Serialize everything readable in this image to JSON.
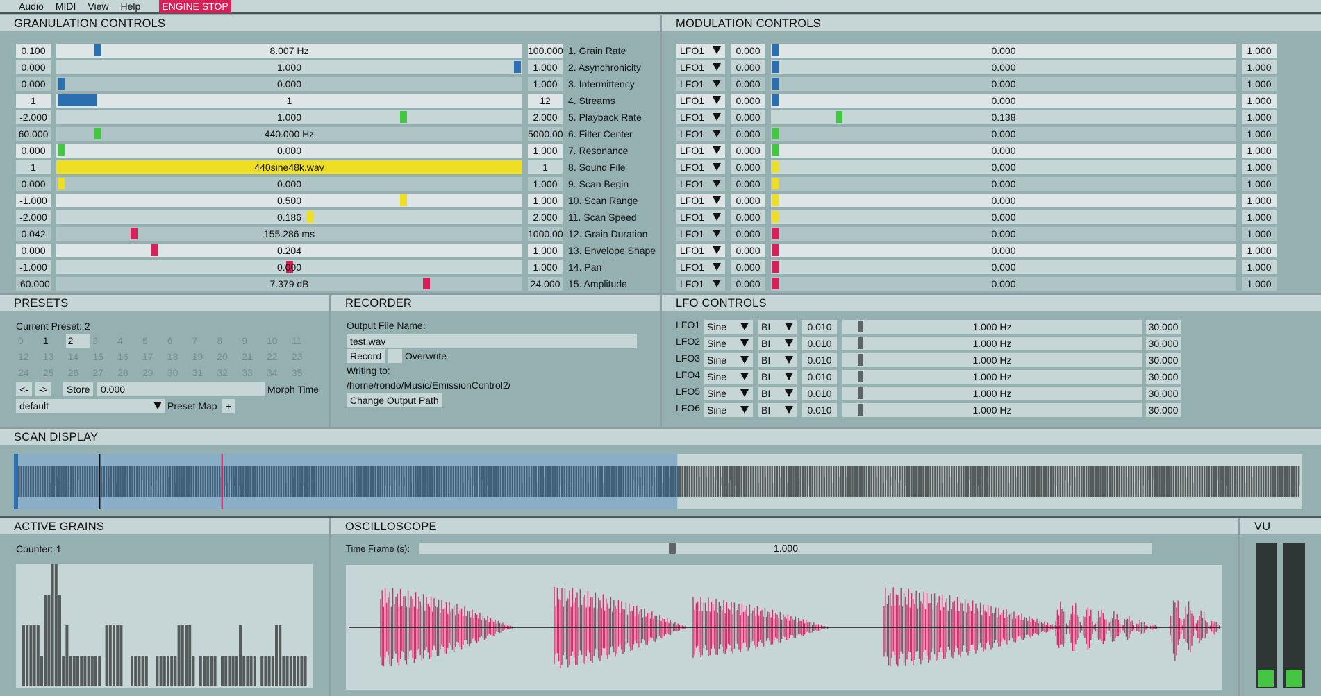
{
  "menu": {
    "items": [
      "Audio",
      "MIDI",
      "View",
      "Help"
    ],
    "engine_button": "ENGINE STOP"
  },
  "colors": {
    "accent_red": "#d52157",
    "blue": "#2c6fb0",
    "green": "#45c642",
    "yellow": "#efdf24",
    "panel": "#94b0b1",
    "header": "#c6d5d5"
  },
  "granulation": {
    "title": "GRANULATION CONTROLS",
    "rows": [
      {
        "min": "0.100",
        "value": "8.007 Hz",
        "max": "100.000",
        "label": "1. Grain Rate",
        "color": "blue",
        "pos": 0.08
      },
      {
        "min": "0.000",
        "value": "1.000",
        "max": "1.000",
        "label": "2. Asynchronicity",
        "color": "blue",
        "pos": 1.0
      },
      {
        "min": "0.000",
        "value": "0.000",
        "max": "1.000",
        "label": "3. Intermittency",
        "color": "blue",
        "pos": 0.0
      },
      {
        "min": "1",
        "value": "1",
        "max": "12",
        "label": "4. Streams",
        "color": "blue",
        "pos": 0.0,
        "fill": true
      },
      {
        "min": "-2.000",
        "value": "1.000",
        "max": "2.000",
        "label": "5. Playback Rate",
        "color": "green",
        "pos": 0.75
      },
      {
        "min": "60.000",
        "value": "440.000 Hz",
        "max": "5000.00",
        "label": "6. Filter Center",
        "color": "green",
        "pos": 0.08
      },
      {
        "min": "0.000",
        "value": "0.000",
        "max": "1.000",
        "label": "7. Resonance",
        "color": "green",
        "pos": 0.0
      },
      {
        "min": "1",
        "value": "440sine48k.wav",
        "max": "1",
        "label": "8. Sound File",
        "color": "yellow",
        "pos": 1.0,
        "full": true
      },
      {
        "min": "0.000",
        "value": "0.000",
        "max": "1.000",
        "label": "9. Scan Begin",
        "color": "yellow",
        "pos": 0.0
      },
      {
        "min": "-1.000",
        "value": "0.500",
        "max": "1.000",
        "label": "10. Scan Range",
        "color": "yellow",
        "pos": 0.75
      },
      {
        "min": "-2.000",
        "value": "0.186",
        "max": "2.000",
        "label": "11. Scan Speed",
        "color": "yellow",
        "pos": 0.546
      },
      {
        "min": "0.042",
        "value": "155.286 ms",
        "max": "1000.00",
        "label": "12. Grain Duration",
        "color": "red",
        "pos": 0.16
      },
      {
        "min": "0.000",
        "value": "0.204",
        "max": "1.000",
        "label": "13. Envelope Shape",
        "color": "red",
        "pos": 0.204
      },
      {
        "min": "-1.000",
        "value": "0.000",
        "max": "1.000",
        "label": "14. Pan",
        "color": "red",
        "pos": 0.5
      },
      {
        "min": "-60.000",
        "value": "7.379 dB",
        "max": "24.000",
        "label": "15. Amplitude",
        "color": "red",
        "pos": 0.8
      }
    ]
  },
  "modulation": {
    "title": "MODULATION CONTROLS",
    "rows": [
      {
        "source": "LFO1",
        "depth_min": "0.000",
        "value": "0.000",
        "max": "1.000",
        "color": "blue",
        "pos": 0.0
      },
      {
        "source": "LFO1",
        "depth_min": "0.000",
        "value": "0.000",
        "max": "1.000",
        "color": "blue",
        "pos": 0.0
      },
      {
        "source": "LFO1",
        "depth_min": "0.000",
        "value": "0.000",
        "max": "1.000",
        "color": "blue",
        "pos": 0.0
      },
      {
        "source": "LFO1",
        "depth_min": "0.000",
        "value": "0.000",
        "max": "1.000",
        "color": "blue",
        "pos": 0.0
      },
      {
        "source": "LFO1",
        "depth_min": "0.000",
        "value": "0.138",
        "max": "1.000",
        "color": "green",
        "pos": 0.138
      },
      {
        "source": "LFO1",
        "depth_min": "0.000",
        "value": "0.000",
        "max": "1.000",
        "color": "green",
        "pos": 0.0
      },
      {
        "source": "LFO1",
        "depth_min": "0.000",
        "value": "0.000",
        "max": "1.000",
        "color": "green",
        "pos": 0.0
      },
      {
        "source": "LFO1",
        "depth_min": "0.000",
        "value": "0.000",
        "max": "1.000",
        "color": "yellow",
        "pos": 0.0
      },
      {
        "source": "LFO1",
        "depth_min": "0.000",
        "value": "0.000",
        "max": "1.000",
        "color": "yellow",
        "pos": 0.0
      },
      {
        "source": "LFO1",
        "depth_min": "0.000",
        "value": "0.000",
        "max": "1.000",
        "color": "yellow",
        "pos": 0.0
      },
      {
        "source": "LFO1",
        "depth_min": "0.000",
        "value": "0.000",
        "max": "1.000",
        "color": "yellow",
        "pos": 0.0
      },
      {
        "source": "LFO1",
        "depth_min": "0.000",
        "value": "0.000",
        "max": "1.000",
        "color": "red",
        "pos": 0.0
      },
      {
        "source": "LFO1",
        "depth_min": "0.000",
        "value": "0.000",
        "max": "1.000",
        "color": "red",
        "pos": 0.0
      },
      {
        "source": "LFO1",
        "depth_min": "0.000",
        "value": "0.000",
        "max": "1.000",
        "color": "red",
        "pos": 0.0
      },
      {
        "source": "LFO1",
        "depth_min": "0.000",
        "value": "0.000",
        "max": "1.000",
        "color": "red",
        "pos": 0.0
      }
    ]
  },
  "presets": {
    "title": "PRESETS",
    "current_label": "Current Preset: 2",
    "numbers": [
      "0",
      "1",
      "2",
      "3",
      "4",
      "5",
      "6",
      "7",
      "8",
      "9",
      "10",
      "11",
      "12",
      "13",
      "14",
      "15",
      "16",
      "17",
      "18",
      "19",
      "20",
      "21",
      "22",
      "23",
      "24",
      "25",
      "26",
      "27",
      "28",
      "29",
      "30",
      "31",
      "32",
      "33",
      "34",
      "35"
    ],
    "active": [
      "1",
      "2"
    ],
    "selected": "2",
    "prev_button": "<-",
    "next_button": "->",
    "store_button": "Store",
    "morph_value": "0.000",
    "morph_label": "Morph Time",
    "map_value": "default",
    "map_label": "Preset Map",
    "add_button": "+"
  },
  "recorder": {
    "title": "RECORDER",
    "output_label": "Output File Name:",
    "output_value": "test.wav",
    "record_button": "Record",
    "overwrite_label": "Overwrite",
    "overwrite_checked": false,
    "writing_label": "Writing to:",
    "path": "/home/rondo/Music/EmissionControl2/",
    "change_path_button": "Change Output Path"
  },
  "lfo": {
    "title": "LFO CONTROLS",
    "rows": [
      {
        "name": "LFO1",
        "shape": "Sine",
        "polarity": "BI",
        "min": "0.010",
        "value": "1.000 Hz",
        "max": "30.000",
        "pos": 0.033
      },
      {
        "name": "LFO2",
        "shape": "Sine",
        "polarity": "BI",
        "min": "0.010",
        "value": "1.000 Hz",
        "max": "30.000",
        "pos": 0.033
      },
      {
        "name": "LFO3",
        "shape": "Sine",
        "polarity": "BI",
        "min": "0.010",
        "value": "1.000 Hz",
        "max": "30.000",
        "pos": 0.033
      },
      {
        "name": "LFO4",
        "shape": "Sine",
        "polarity": "BI",
        "min": "0.010",
        "value": "1.000 Hz",
        "max": "30.000",
        "pos": 0.033
      },
      {
        "name": "LFO5",
        "shape": "Sine",
        "polarity": "BI",
        "min": "0.010",
        "value": "1.000 Hz",
        "max": "30.000",
        "pos": 0.033
      },
      {
        "name": "LFO6",
        "shape": "Sine",
        "polarity": "BI",
        "min": "0.010",
        "value": "1.000 Hz",
        "max": "30.000",
        "pos": 0.033
      }
    ]
  },
  "scan": {
    "title": "SCAN DISPLAY",
    "selection_end": 0.5,
    "playhead": 0.055,
    "scan_head": 0.136
  },
  "grains": {
    "title": "ACTIVE GRAINS",
    "counter_label": "Counter: 1",
    "levels": [
      2,
      2,
      2,
      2,
      2,
      1,
      3,
      3,
      4,
      4,
      3,
      1,
      2,
      1,
      1,
      1,
      1,
      1,
      1,
      1,
      1,
      1,
      0,
      2,
      2,
      2,
      2,
      2,
      0,
      0,
      1,
      1,
      1,
      1,
      1,
      0,
      0,
      1,
      1,
      1,
      1,
      1,
      1,
      2,
      2,
      2,
      2,
      1,
      0,
      1,
      1,
      1,
      1,
      1,
      0,
      1,
      1,
      1,
      1,
      1,
      2,
      1,
      1,
      1,
      1,
      0,
      1,
      1,
      1,
      1,
      2,
      2,
      1,
      1,
      1,
      1,
      1,
      1,
      1
    ]
  },
  "oscilloscope": {
    "title": "OSCILLOSCOPE",
    "time_label": "Time Frame (s):",
    "time_value": "1.000",
    "time_pos": 0.34
  },
  "vu": {
    "title": "VU",
    "left": 0.12,
    "right": 0.12
  }
}
